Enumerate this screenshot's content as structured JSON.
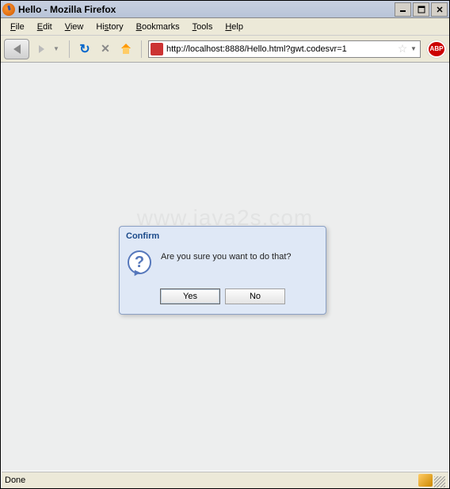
{
  "window": {
    "title": "Hello - Mozilla Firefox",
    "minimize": "_",
    "maximize": "□",
    "close": "×"
  },
  "menu": {
    "file": "File",
    "edit": "Edit",
    "view": "View",
    "history": "History",
    "bookmarks": "Bookmarks",
    "tools": "Tools",
    "help": "Help"
  },
  "toolbar": {
    "url": "http://localhost:8888/Hello.html?gwt.codesvr=1",
    "abp": "ABP"
  },
  "watermark": "www.java2s.com",
  "dialog": {
    "title": "Confirm",
    "icon_glyph": "?",
    "message": "Are you sure you want to do that?",
    "yes": "Yes",
    "no": "No"
  },
  "status": {
    "text": "Done"
  }
}
